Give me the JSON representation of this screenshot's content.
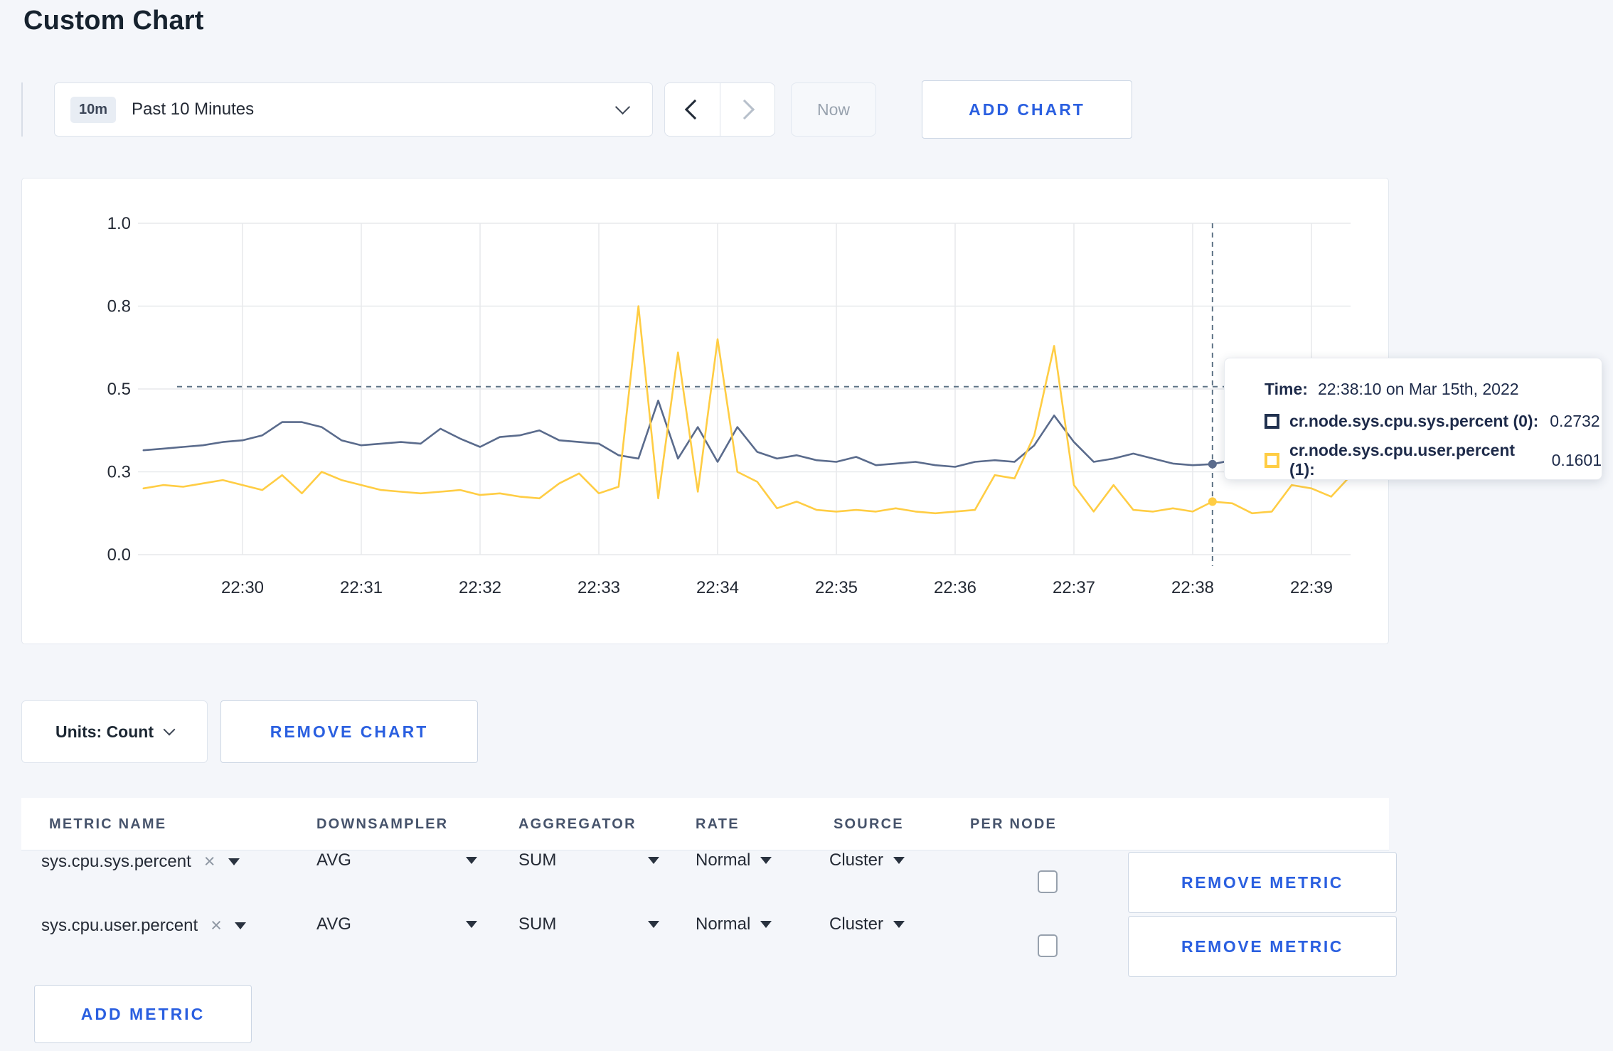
{
  "page_title": "Custom Chart",
  "toolbar": {
    "range_badge": "10m",
    "range_label": "Past 10 Minutes",
    "now_label": "Now",
    "add_chart_label": "ADD CHART"
  },
  "chart_data": {
    "type": "line",
    "title": "",
    "xlabel": "",
    "ylabel": "",
    "grid": true,
    "legend_position": "tooltip",
    "x_axis": {
      "tick_labels": [
        "22:30",
        "22:31",
        "22:32",
        "22:33",
        "22:34",
        "22:35",
        "22:36",
        "22:37",
        "22:38",
        "22:39"
      ],
      "tick_start_sec": 1800,
      "tick_step_sec": 60,
      "data_start_sec": 1750,
      "data_step_sec": 10
    },
    "y_axis": {
      "tick_values": [
        0,
        0.25,
        0.5,
        0.75,
        1.0
      ],
      "tick_labels": [
        "0.0",
        "0.3",
        "0.5",
        "0.8",
        "1.0"
      ],
      "range": [
        0,
        1
      ]
    },
    "series": [
      {
        "name": "cr.node.sys.cpu.sys.percent",
        "color": "#5a6b8c",
        "values": [
          0.315,
          0.32,
          0.325,
          0.33,
          0.34,
          0.345,
          0.36,
          0.4,
          0.4,
          0.385,
          0.345,
          0.33,
          0.335,
          0.34,
          0.335,
          0.38,
          0.35,
          0.325,
          0.355,
          0.36,
          0.375,
          0.345,
          0.34,
          0.335,
          0.3,
          0.29,
          0.465,
          0.29,
          0.385,
          0.28,
          0.385,
          0.31,
          0.29,
          0.3,
          0.285,
          0.28,
          0.295,
          0.27,
          0.275,
          0.28,
          0.27,
          0.265,
          0.28,
          0.285,
          0.28,
          0.33,
          0.42,
          0.34,
          0.28,
          0.29,
          0.305,
          0.29,
          0.275,
          0.27,
          0.2732,
          0.285,
          0.275,
          0.295,
          0.28,
          0.275,
          0.28,
          0.29
        ]
      },
      {
        "name": "cr.node.sys.cpu.user.percent",
        "color": "#ffcd44",
        "values": [
          0.2,
          0.21,
          0.205,
          0.215,
          0.225,
          0.21,
          0.195,
          0.24,
          0.185,
          0.25,
          0.225,
          0.21,
          0.195,
          0.19,
          0.185,
          0.19,
          0.195,
          0.18,
          0.185,
          0.175,
          0.17,
          0.215,
          0.245,
          0.185,
          0.205,
          0.75,
          0.17,
          0.61,
          0.19,
          0.65,
          0.25,
          0.22,
          0.14,
          0.16,
          0.135,
          0.13,
          0.135,
          0.13,
          0.14,
          0.13,
          0.125,
          0.13,
          0.135,
          0.24,
          0.23,
          0.36,
          0.63,
          0.21,
          0.13,
          0.21,
          0.135,
          0.13,
          0.14,
          0.13,
          0.1601,
          0.155,
          0.125,
          0.13,
          0.21,
          0.2,
          0.175,
          0.24
        ]
      }
    ],
    "crosshair": {
      "time_sec": 2290,
      "time_label": "22:38:10",
      "hline_value": 0.507,
      "dot_values": [
        0.2732,
        0.1601
      ],
      "line_color": "#5d7285"
    }
  },
  "tooltip": {
    "time_label": "Time:",
    "time_value": "22:38:10 on Mar 15th, 2022",
    "rows": [
      {
        "label": "cr.node.sys.cpu.sys.percent (0):",
        "value": "0.2732",
        "color": "#21314f"
      },
      {
        "label": "cr.node.sys.cpu.user.percent (1):",
        "value": "0.1601",
        "color": "#ffcd44"
      }
    ]
  },
  "chart_footer": {
    "units_label": "Units: Count",
    "remove_chart_label": "REMOVE CHART"
  },
  "metrics_table": {
    "headers": [
      "METRIC NAME",
      "DOWNSAMPLER",
      "AGGREGATOR",
      "RATE",
      "SOURCE",
      "PER NODE"
    ],
    "rows": [
      {
        "metric": "sys.cpu.sys.percent",
        "clear_icon": "×",
        "downsampler": "AVG",
        "aggregator": "SUM",
        "rate": "Normal",
        "source": "Cluster",
        "per_node_checked": false,
        "remove_label": "REMOVE METRIC"
      },
      {
        "metric": "sys.cpu.user.percent",
        "clear_icon": "×",
        "downsampler": "AVG",
        "aggregator": "SUM",
        "rate": "Normal",
        "source": "Cluster",
        "per_node_checked": false,
        "remove_label": "REMOVE METRIC"
      }
    ],
    "add_metric_label": "ADD METRIC"
  },
  "colors": {
    "accent_blue": "#2a5fe0",
    "grid": "#e7e9ec",
    "axis_text": "#242a35"
  }
}
